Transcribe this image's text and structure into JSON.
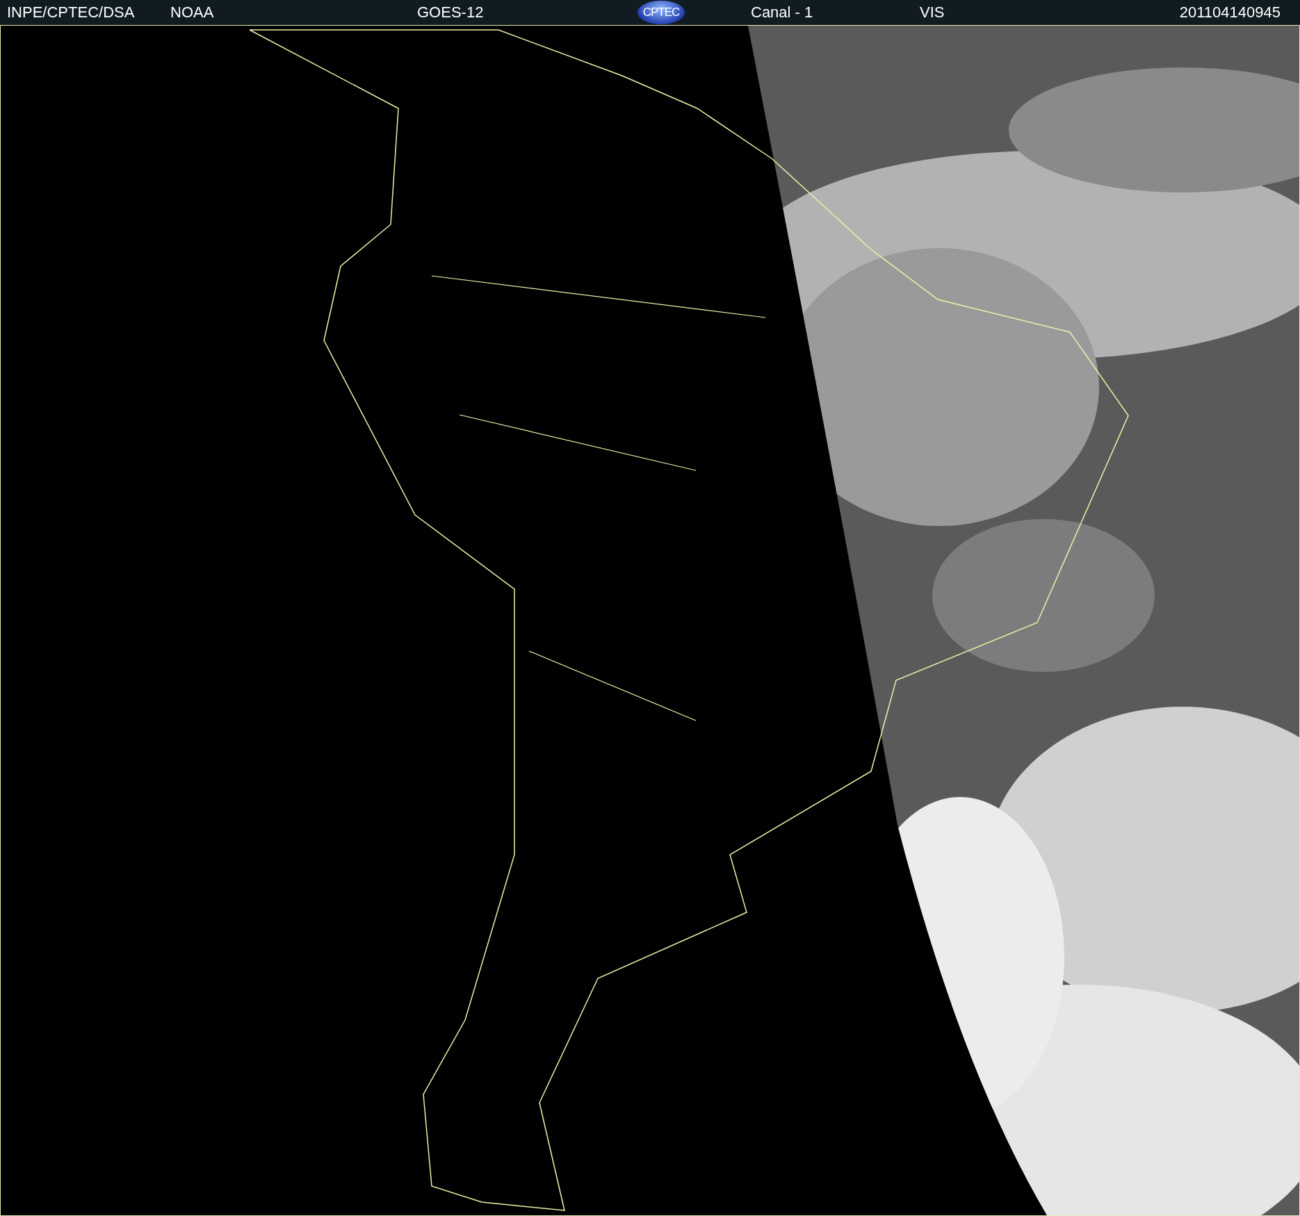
{
  "header": {
    "source": "INPE/CPTEC/DSA",
    "agency": "NOAA",
    "satellite": "GOES-12",
    "logo": "CPTEC",
    "channel": "Canal - 1",
    "band": "VIS",
    "timestamp": "201104140945"
  }
}
